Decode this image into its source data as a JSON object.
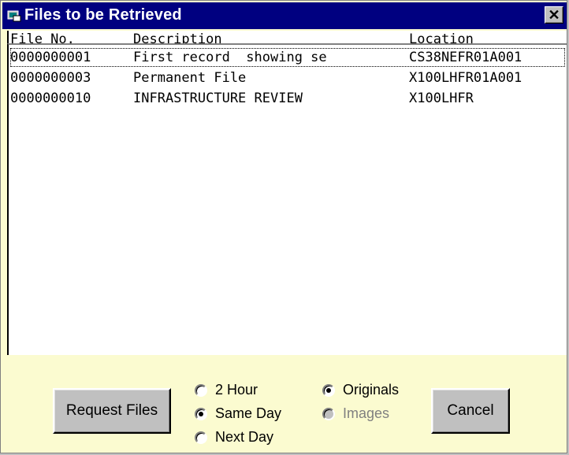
{
  "window": {
    "title": "Files to be Retrieved",
    "close_glyph": "✕"
  },
  "list": {
    "headers": [
      "File No.",
      "Description",
      "Location"
    ],
    "rows": [
      {
        "file_no": "0000000001",
        "description": "First record  showing se",
        "location": "CS38NEFR01A001"
      },
      {
        "file_no": "0000000003",
        "description": "Permanent File",
        "location": "X100LHFR01A001"
      },
      {
        "file_no": "0000000010",
        "description": "INFRASTRUCTURE REVIEW",
        "location": "X100LHFR"
      }
    ]
  },
  "buttons": {
    "request": "Request Files",
    "cancel": "Cancel"
  },
  "speed": {
    "options": [
      {
        "label": "2 Hour",
        "selected": false
      },
      {
        "label": "Same Day",
        "selected": true
      },
      {
        "label": "Next Day",
        "selected": false
      }
    ]
  },
  "type": {
    "options": [
      {
        "label": "Originals",
        "selected": true,
        "disabled": false
      },
      {
        "label": "Images",
        "selected": false,
        "disabled": true
      }
    ]
  }
}
